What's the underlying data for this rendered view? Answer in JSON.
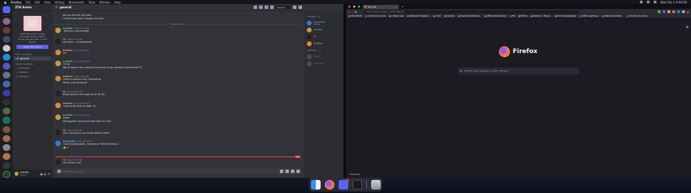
{
  "menubar": {
    "app": "Firefox",
    "items": [
      "File",
      "Edit",
      "View",
      "History",
      "Bookmarks",
      "Tools",
      "Window",
      "Help"
    ],
    "clock": "Wed Feb 1 9:08 PM"
  },
  "discord": {
    "server_name": "ZTH Arena",
    "invite": {
      "text": "Want this server to feel yourself? Unlock custom server banners with 7 more boosts.",
      "button": "Boost This Server"
    },
    "text_category": "Text Channels",
    "text_channels": [
      {
        "name": "general"
      }
    ],
    "voice_category": "Voice Channels",
    "voice_channels": [
      {
        "name": "Channel"
      },
      {
        "name": "Retired"
      },
      {
        "name": "General"
      }
    ],
    "channel_title": "general",
    "search_placeholder": "Search",
    "date_divider": "February 1, 2023",
    "messages": [
      {
        "author": "",
        "time": "",
        "lines": [
          "No can do one one way",
          "I think they have 2 boxes for this!"
        ]
      },
      {
        "author": "Landon",
        "time": "Today at 8:38 PM",
        "lines": [
          "@tmSpc said tonight"
        ]
      },
      {
        "author": "DJ",
        "time": "Today at 8:38 PM",
        "lines": [
          "we have... a proposition"
        ]
      },
      {
        "author": "Anthon",
        "time": "Today at 8:38 PM",
        "lines": [
          "Ok"
        ]
      },
      {
        "author": "Landon",
        "time": "Today at 8:39 PM",
        "lines": [
          "Oh ok",
          "We all gonna do a private (or public if you wanted) Hyhemore?!?!"
        ]
      },
      {
        "author": "Anthon",
        "time": "Today at 8:40 PM",
        "lines": [
          "Hmmm sounds very interesting",
          "When y'all thinking?"
        ]
      },
      {
        "author": "DJ",
        "time": "Today at 8:40 PM",
        "lines": [
          "Brett said he can't get on til 10 ish"
        ]
      },
      {
        "author": "Anthon",
        "time": "Today at 8:42 PM",
        "lines": [
          "I should be able to after 10"
        ]
      },
      {
        "author": "Landon",
        "time": "Today at 8:44 PM",
        "lines": [
          "Noice",
          "@haypeleb you found both with us tho?"
        ]
      },
      {
        "author": "DJ",
        "time": "Today at 8:46 PM",
        "lines": [
          "yea, you get to use those Adrian skills"
        ]
      },
      {
        "author": "Haypeleb",
        "time": "Today at 8:52 PM",
        "lines": [
          "I love playing both, Comets or Team Fortress 2",
          "👍 2"
        ]
      },
      {
        "author": "DJ",
        "time": "Today at 8:58 PM",
        "lines": [
          "so is that a no?"
        ]
      }
    ],
    "new_tag": "NEW",
    "composer_placeholder": "Message #general",
    "members": {
      "online_header": "Online — 4",
      "online": [
        {
          "name": "haypeleb",
          "sub": "Playing"
        },
        {
          "name": "Landon",
          "sub": ""
        },
        {
          "name": "DJ",
          "sub": ""
        },
        {
          "name": "Anthon",
          "sub": ""
        }
      ],
      "offline_header": "Offline — 2",
      "offline": [
        {
          "name": "Brett"
        },
        {
          "name": "Raelynn"
        }
      ]
    },
    "user": {
      "name": "Landon",
      "status": "#1337"
    }
  },
  "firefox": {
    "tab_title": "New Tab",
    "url_placeholder": "Search with Google or enter address",
    "bookmarks": [
      "VRC rMetoth",
      "Landon's Concourse",
      "x Paper Login",
      "Behavioral Engineeri...",
      "Index",
      "Calendar",
      "Operations Dashboar...",
      "Official Release Slack",
      "HN",
      "FitTrack",
      "Mechanic - Project...",
      "Evo Knowledge Base",
      "LURNA (Lightning)",
      "Default Credentials...",
      "Shop the Intro Items..."
    ],
    "brand": "Firefox",
    "search_placeholder": "Search with Google or enter address",
    "terminal_label": "Terminal"
  },
  "colors": {
    "discord_bg": "#313338",
    "blurple": "#5865f2",
    "firefox_bg": "#1c1b22"
  }
}
